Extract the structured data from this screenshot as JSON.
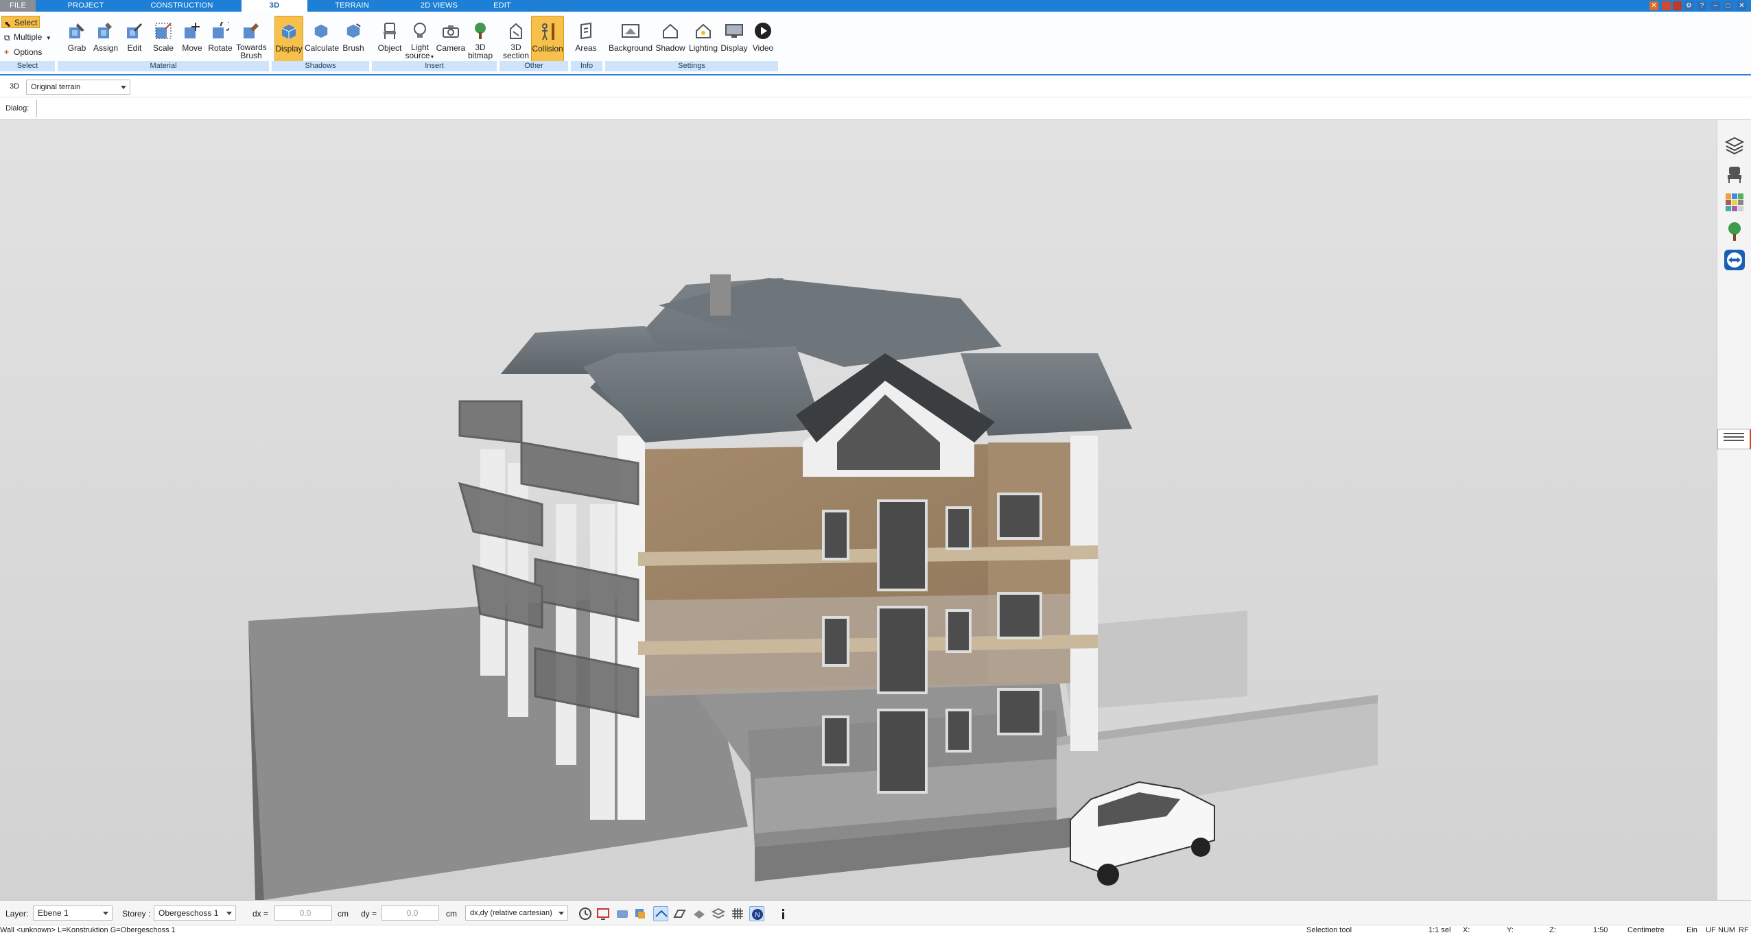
{
  "menu": {
    "tabs": [
      "FILE",
      "PROJECT",
      "CONSTRUCTION",
      "3D",
      "TERRAIN",
      "2D VIEWS",
      "EDIT"
    ],
    "active": "3D"
  },
  "ribbon": {
    "select_label": "Select",
    "multiple_label": "Multiple",
    "options_label": "Options",
    "material": {
      "grab": "Grab",
      "assign": "Assign",
      "edit": "Edit",
      "scale": "Scale",
      "move": "Move",
      "rotate": "Rotate",
      "towards1": "Towards",
      "towards2": "Brush"
    },
    "shadows": {
      "display": "Display",
      "calculate": "Calculate",
      "brush": "Brush"
    },
    "insert": {
      "object": "Object",
      "light1": "Light",
      "light2": "source",
      "camera": "Camera",
      "bitmap1": "3D",
      "bitmap2": "bitmap"
    },
    "other": {
      "section1": "3D",
      "section2": "section",
      "collision": "Collision"
    },
    "info": {
      "areas": "Areas"
    },
    "settings": {
      "background": "Background",
      "shadow": "Shadow",
      "lighting": "Lighting",
      "display": "Display",
      "video": "Video"
    },
    "groups": {
      "select": "Select",
      "material": "Material",
      "shadows": "Shadows",
      "insert": "Insert",
      "other": "Other",
      "info": "Info",
      "settings": "Settings"
    }
  },
  "view_row": {
    "label": "3D",
    "terrain_value": "Original terrain"
  },
  "dialog_row": {
    "label": "Dialog:"
  },
  "bottom": {
    "layer_label": "Layer:",
    "layer_value": "Ebene 1",
    "storey_label": "Storey :",
    "storey_value": "Obergeschoss 1",
    "dx_label": "dx =",
    "dx_value": "0.0",
    "dx_unit": "cm",
    "dy_label": "dy =",
    "dy_value": "0.0",
    "dy_unit": "cm",
    "coord_mode": "dx,dy (relative cartesian)"
  },
  "status": {
    "left": "Wall <unknown> L=Konstruktion G=Obergeschoss 1",
    "tool": "Selection tool",
    "sel": "1:1 sel",
    "x": "X:",
    "y": "Y:",
    "z": "Z:",
    "scale": "1:50",
    "unit": "Centimetre",
    "ein": "Ein",
    "uf": "UF",
    "num": "NUM",
    "rf": "RF"
  },
  "colors": {
    "accent": "#1e7fd6",
    "active_tool": "#f6c04a",
    "viewport_bg": "#d9d9d9"
  }
}
